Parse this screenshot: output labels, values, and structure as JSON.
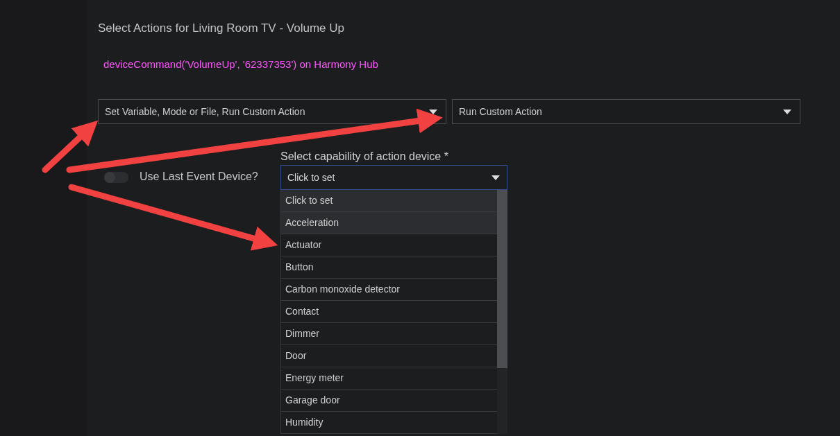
{
  "title": "Select Actions for Living Room TV - Volume Up",
  "command": "deviceCommand('VolumeUp', '62337353') on Harmony Hub",
  "action_selects": [
    {
      "value": "Set Variable, Mode or File, Run Custom Action"
    },
    {
      "value": "Run Custom Action"
    }
  ],
  "use_last_event_device": {
    "label": "Use Last Event Device?",
    "on": false
  },
  "capability": {
    "label": "Select capability of action device *",
    "value": "Click to set",
    "options": [
      {
        "label": "Click to set",
        "highlighted": true
      },
      {
        "label": "Acceleration",
        "highlighted": true
      },
      {
        "label": "Actuator",
        "highlighted": false
      },
      {
        "label": "Button",
        "highlighted": false
      },
      {
        "label": "Carbon monoxide detector",
        "highlighted": false
      },
      {
        "label": "Contact",
        "highlighted": false
      },
      {
        "label": "Dimmer",
        "highlighted": false
      },
      {
        "label": "Door",
        "highlighted": false
      },
      {
        "label": "Energy meter",
        "highlighted": false
      },
      {
        "label": "Garage door",
        "highlighted": false
      },
      {
        "label": "Humidity",
        "highlighted": false
      }
    ]
  }
}
